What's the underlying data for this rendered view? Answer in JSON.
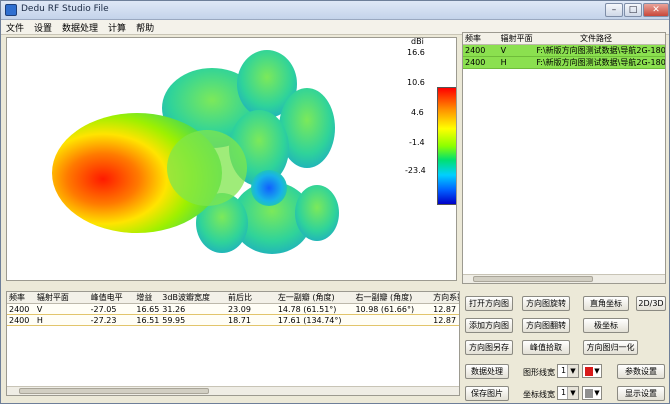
{
  "window": {
    "title": "Dedu RF Studio File"
  },
  "menu": [
    "文件",
    "设置",
    "数据处理",
    "计算",
    "帮助"
  ],
  "colorbar": {
    "unit": "dBi",
    "ticks": [
      "16.6",
      "10.6",
      "4.6",
      "-1.4",
      "-23.4"
    ]
  },
  "file_table": {
    "columns": [
      "频率",
      "辐射平面",
      "文件路径"
    ],
    "rows": [
      [
        "2400",
        "V",
        "F:\\新版方向图测试数据\\导航2G-180"
      ],
      [
        "2400",
        "H",
        "F:\\新版方向图测试数据\\导航2G-180"
      ]
    ]
  },
  "result_table": {
    "columns": [
      "频率",
      "辐射平面",
      "峰值电平",
      "增益",
      "3dB波瓣宽度",
      "前后比",
      "左一副瓣 (角度)",
      "右一副瓣 (角度)",
      "方向系数"
    ],
    "rows": [
      [
        "2400",
        "V",
        "-27.05",
        "16.65",
        "31.26",
        "23.09",
        "14.78 (61.51°)",
        "10.98 (61.66°)",
        "12.87"
      ],
      [
        "2400",
        "H",
        "-27.23",
        "16.51",
        "59.95",
        "18.71",
        "17.61 (134.74°)",
        "",
        "12.87"
      ]
    ]
  },
  "buttons": {
    "open": "打开方向图",
    "rotate": "方向图旋转",
    "rect": "直角坐标",
    "mode": "2D/3D",
    "add": "添加方向图",
    "flip": "方向图翻转",
    "polar": "极坐标",
    "save": "方向图另存",
    "peak": "峰值拾取",
    "normalize": "方向图归一化",
    "process": "数据处理",
    "params": "参数设置",
    "export": "保存图片",
    "display": "显示设置"
  },
  "settings": {
    "graph_line_label": "图形线宽",
    "graph_line_value": "1",
    "graph_color": "#d81a1a",
    "axis_line_label": "坐标线宽",
    "axis_line_value": "1",
    "axis_color": "#909090"
  }
}
